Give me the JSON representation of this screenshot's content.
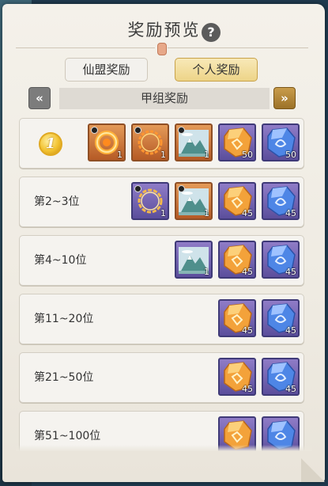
{
  "title": "奖励预览",
  "help_icon_glyph": "?",
  "tabs": [
    {
      "label": "仙盟奖励",
      "active": false
    },
    {
      "label": "个人奖励",
      "active": true
    }
  ],
  "group": {
    "label": "甲组奖励",
    "prev_glyph": "«",
    "next_glyph": "»"
  },
  "colors": {
    "accent": "#edd488",
    "item_orange": "#c9722f",
    "item_purple": "#5b4e9c"
  },
  "rows": [
    {
      "rank": "1",
      "items": [
        {
          "icon": "fire-ring-icon",
          "count": "1",
          "bg": "orange",
          "timed": true
        },
        {
          "icon": "flame-halo-icon",
          "count": "1",
          "bg": "orange",
          "timed": true
        },
        {
          "icon": "mountain-painting-icon",
          "count": "1",
          "bg": "orange",
          "timed": true
        },
        {
          "icon": "orange-crystal-icon",
          "count": "50",
          "bg": "purple",
          "timed": false
        },
        {
          "icon": "blue-crystal-icon",
          "count": "50",
          "bg": "purple",
          "timed": false
        }
      ]
    },
    {
      "rank": "第2~3位",
      "items": [
        {
          "icon": "golden-ring-icon",
          "count": "1",
          "bg": "purple",
          "timed": true
        },
        {
          "icon": "mountain-painting-icon",
          "count": "1",
          "bg": "orange",
          "timed": true
        },
        {
          "icon": "orange-crystal-icon",
          "count": "45",
          "bg": "purple",
          "timed": false
        },
        {
          "icon": "blue-crystal-icon",
          "count": "45",
          "bg": "purple",
          "timed": false
        }
      ]
    },
    {
      "rank": "第4~10位",
      "items": [
        {
          "icon": "mountain-painting-icon",
          "count": "1",
          "bg": "purple",
          "timed": false
        },
        {
          "icon": "orange-crystal-icon",
          "count": "45",
          "bg": "purple",
          "timed": false
        },
        {
          "icon": "blue-crystal-icon",
          "count": "45",
          "bg": "purple",
          "timed": false
        }
      ]
    },
    {
      "rank": "第11~20位",
      "items": [
        {
          "icon": "orange-crystal-icon",
          "count": "45",
          "bg": "purple",
          "timed": false
        },
        {
          "icon": "blue-crystal-icon",
          "count": "45",
          "bg": "purple",
          "timed": false
        }
      ]
    },
    {
      "rank": "第21~50位",
      "items": [
        {
          "icon": "orange-crystal-icon",
          "count": "45",
          "bg": "purple",
          "timed": false
        },
        {
          "icon": "blue-crystal-icon",
          "count": "45",
          "bg": "purple",
          "timed": false
        }
      ]
    },
    {
      "rank": "第51~100位",
      "items": [
        {
          "icon": "orange-crystal-icon",
          "count": "",
          "bg": "purple",
          "timed": false
        },
        {
          "icon": "blue-crystal-icon",
          "count": "",
          "bg": "purple",
          "timed": false
        }
      ]
    }
  ]
}
